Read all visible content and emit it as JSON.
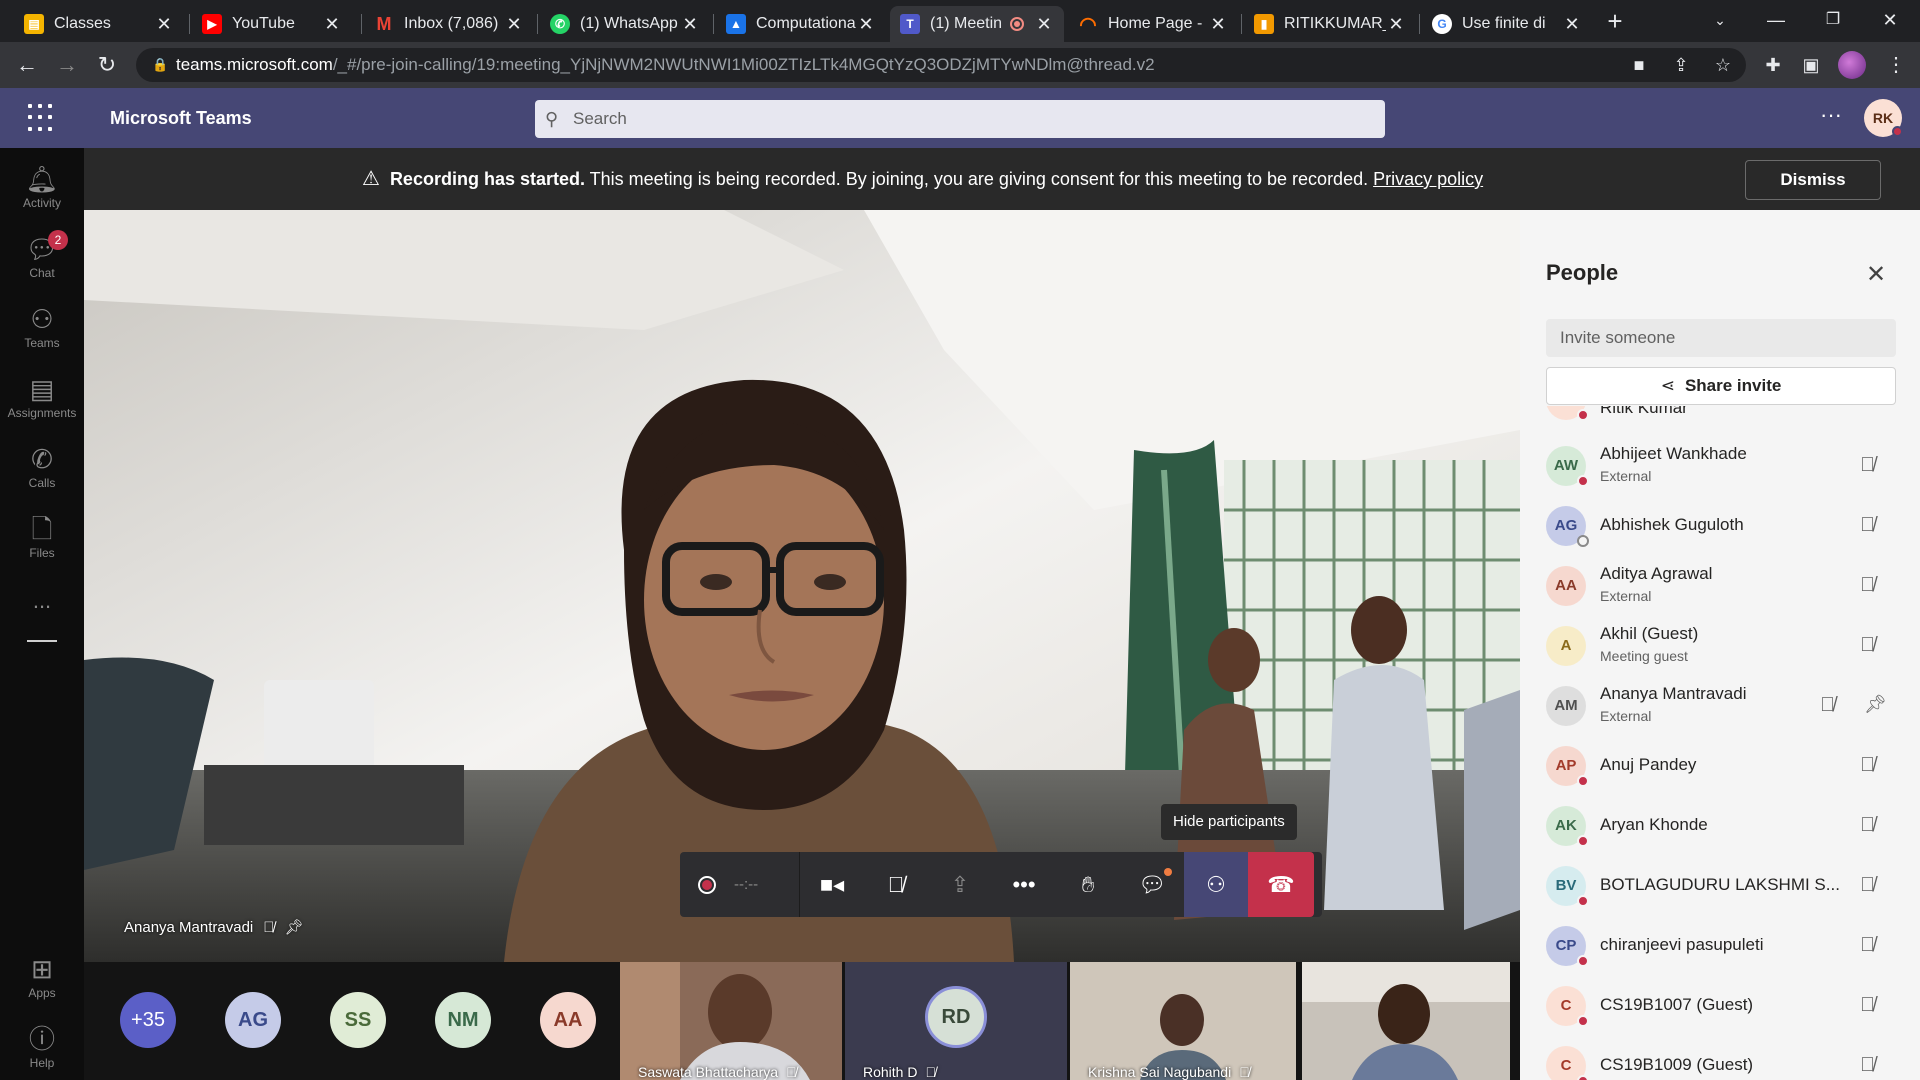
{
  "browser": {
    "tabs": [
      {
        "title": "Classes",
        "icon": "google-classroom-icon",
        "color": "#f4b400"
      },
      {
        "title": "YouTube",
        "icon": "youtube-icon",
        "color": "#ff0000"
      },
      {
        "title": "Inbox (7,086)",
        "icon": "gmail-icon",
        "color": "#ea4335"
      },
      {
        "title": "(1) WhatsApp",
        "icon": "whatsapp-icon",
        "color": "#25d366"
      },
      {
        "title": "Computationa",
        "icon": "classroom-icon",
        "color": "#1a73e8"
      },
      {
        "title": "(1) Meetin",
        "icon": "teams-icon",
        "color": "#5059c9"
      },
      {
        "title": "Home Page - ",
        "icon": "swirl-icon",
        "color": "#ff6d00"
      },
      {
        "title": "RITIKKUMAR_",
        "icon": "document-icon",
        "color": "#f29900"
      },
      {
        "title": "Use finite di",
        "icon": "google-icon",
        "color": "#4285f4"
      }
    ],
    "url_host": "teams.microsoft.com",
    "url_path": "/_#/pre-join-calling/19:meeting_YjNjNWM2NWUtNWI1Mi00ZTIzLTk4MGQtYzQ3ODZjMTYwNDlm@thread.v2"
  },
  "teams": {
    "app_name": "Microsoft Teams",
    "search_placeholder": "Search",
    "user_initials": "RK",
    "rail": [
      {
        "label": "Activity",
        "icon": "bell-icon"
      },
      {
        "label": "Chat",
        "icon": "chat-icon",
        "badge": "2"
      },
      {
        "label": "Teams",
        "icon": "teams-icon"
      },
      {
        "label": "Assignments",
        "icon": "assignments-icon"
      },
      {
        "label": "Calls",
        "icon": "phone-icon"
      },
      {
        "label": "Files",
        "icon": "file-icon"
      },
      {
        "label": "Apps",
        "icon": "apps-icon"
      },
      {
        "label": "Help",
        "icon": "help-icon"
      }
    ],
    "more_label": "..."
  },
  "banner": {
    "bold": "Recording has started.",
    "text": " This meeting is being recorded. By joining, you are giving consent for this meeting to be recorded. ",
    "link": "Privacy policy",
    "dismiss": "Dismiss"
  },
  "stage": {
    "speaker_name": "Ananya Mantravadi",
    "tooltip": "Hide participants",
    "record_timer": "--:--"
  },
  "filmstrip": {
    "overflow": "+35",
    "avatars": [
      {
        "initials": "AG",
        "bg": "#c5cbe8",
        "fg": "#3a4a8a"
      },
      {
        "initials": "SS",
        "bg": "#e0ecd6",
        "fg": "#4a6a3a"
      },
      {
        "initials": "NM",
        "bg": "#d6e8d6",
        "fg": "#3a6a4a"
      },
      {
        "initials": "AA",
        "bg": "#f6d8cf",
        "fg": "#8a3a2a"
      }
    ],
    "videos": [
      {
        "name": "Saswata Bhattacharya"
      },
      {
        "name": "Rohith D",
        "initials": "RD"
      },
      {
        "name": "Krishna Sai Nagubandi"
      },
      {
        "name": ""
      }
    ]
  },
  "people": {
    "title": "People",
    "invite_placeholder": "Invite someone",
    "share_label": "Share invite",
    "partial_name": "Ritik Kumar",
    "participants": [
      {
        "initials": "AW",
        "name": "Abhijeet Wankhade",
        "sub": "External",
        "bg": "#d6ead8",
        "fg": "#3a6a4a",
        "status": "busy"
      },
      {
        "initials": "AG",
        "name": "Abhishek Guguloth",
        "sub": "",
        "bg": "#c5cbe8",
        "fg": "#3a4a8a",
        "status": "away"
      },
      {
        "initials": "AA",
        "name": "Aditya Agrawal",
        "sub": "External",
        "bg": "#f6d8cf",
        "fg": "#8a3a2a",
        "status": "none"
      },
      {
        "initials": "A",
        "name": "Akhil (Guest)",
        "sub": "Meeting guest",
        "bg": "#f7ecc8",
        "fg": "#8a6a1a",
        "status": "none"
      },
      {
        "initials": "AM",
        "name": "Ananya Mantravadi",
        "sub": "External",
        "bg": "#dedede",
        "fg": "#505050",
        "status": "none",
        "pinned": true
      },
      {
        "initials": "AP",
        "name": "Anuj Pandey",
        "sub": "",
        "bg": "#f6d8cf",
        "fg": "#a33a2a",
        "status": "busy"
      },
      {
        "initials": "AK",
        "name": "Aryan Khonde",
        "sub": "",
        "bg": "#d6ead8",
        "fg": "#3a6a4a",
        "status": "busy"
      },
      {
        "initials": "BV",
        "name": "BOTLAGUDURU LAKSHMI S...",
        "sub": "",
        "bg": "#d6ecef",
        "fg": "#2a6a7a",
        "status": "busy"
      },
      {
        "initials": "CP",
        "name": "chiranjeevi pasupuleti",
        "sub": "",
        "bg": "#c5cbe8",
        "fg": "#3a4a8a",
        "status": "busy"
      },
      {
        "initials": "C",
        "name": "CS19B1007 (Guest)",
        "sub": "",
        "bg": "#fbe0d5",
        "fg": "#a33a2a",
        "status": "busy"
      },
      {
        "initials": "C",
        "name": "CS19B1009 (Guest)",
        "sub": "",
        "bg": "#fbe0d5",
        "fg": "#a33a2a",
        "status": "busy"
      }
    ]
  }
}
